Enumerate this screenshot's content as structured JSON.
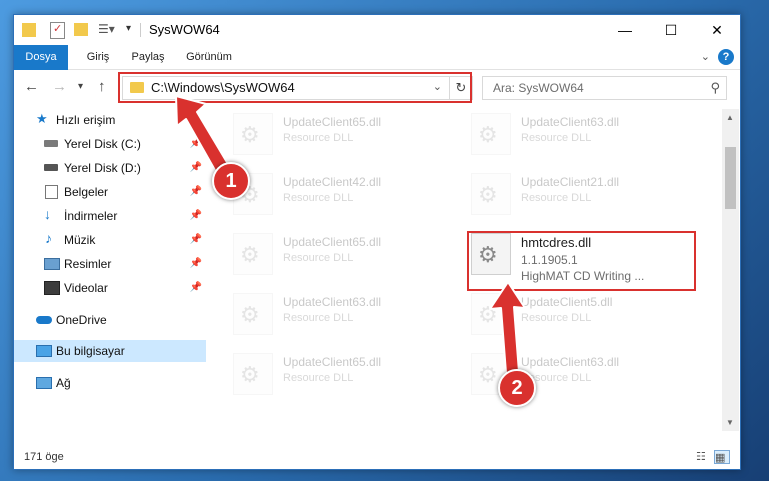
{
  "window": {
    "title": "SysWOW64",
    "controls": {
      "minimize": "—",
      "maximize": "☐",
      "close": "✕"
    }
  },
  "ribbon": {
    "tabs": [
      "Dosya",
      "Giriş",
      "Paylaş",
      "Görünüm"
    ],
    "help": "?"
  },
  "nav": {
    "back": "←",
    "forward": "→",
    "recent": "▾",
    "up": "↑",
    "address": "C:\\Windows\\SysWOW64",
    "address_dropdown": "⌄",
    "refresh": "↻",
    "search_placeholder": "Ara: SysWOW64",
    "search_icon": "⚲"
  },
  "sidebar": {
    "items": [
      {
        "label": "Hızlı erişim",
        "icon": "star-icon",
        "pinned": false
      },
      {
        "label": "Yerel Disk (C:)",
        "icon": "drive-icon",
        "pinned": true
      },
      {
        "label": "Yerel Disk (D:)",
        "icon": "drive-icon",
        "pinned": true
      },
      {
        "label": "Belgeler",
        "icon": "documents-icon",
        "pinned": true
      },
      {
        "label": "İndirmeler",
        "icon": "download-icon",
        "pinned": true
      },
      {
        "label": "Müzik",
        "icon": "music-icon",
        "pinned": true
      },
      {
        "label": "Resimler",
        "icon": "pictures-icon",
        "pinned": true
      },
      {
        "label": "Videolar",
        "icon": "video-icon",
        "pinned": true
      },
      {
        "label": "OneDrive",
        "icon": "cloud-icon",
        "pinned": false
      },
      {
        "label": "Bu bilgisayar",
        "icon": "computer-icon",
        "pinned": false,
        "selected": true
      },
      {
        "label": "Ağ",
        "icon": "network-icon",
        "pinned": false
      }
    ],
    "pin_glyph": "📌"
  },
  "files": {
    "left": [
      {
        "name": "UpdateClient65.dll",
        "desc": "Resource DLL"
      },
      {
        "name": "UpdateClient42.dll",
        "desc": "Resource DLL"
      },
      {
        "name": "UpdateClient65.dll",
        "desc": "Resource DLL"
      },
      {
        "name": "UpdateClient63.dll",
        "desc": "Resource DLL"
      },
      {
        "name": "UpdateClient65.dll",
        "desc": "Resource DLL"
      }
    ],
    "right": [
      {
        "name": "UpdateClient63.dll",
        "desc": "Resource DLL"
      },
      {
        "name": "UpdateClient21.dll",
        "desc": "Resource DLL"
      },
      {
        "name": "UpdateClient5.dll",
        "desc": "Resource DLL"
      },
      {
        "name": "UpdateClient63.dll",
        "desc": "Resource DLL"
      }
    ],
    "highlighted": {
      "name": "hmtcdres.dll",
      "version": "1.1.1905.1",
      "desc": "HighMAT CD Writing ..."
    }
  },
  "status": {
    "count": "171 öge"
  },
  "annotations": {
    "step1": "1",
    "step2": "2",
    "color": "#d9312e"
  }
}
